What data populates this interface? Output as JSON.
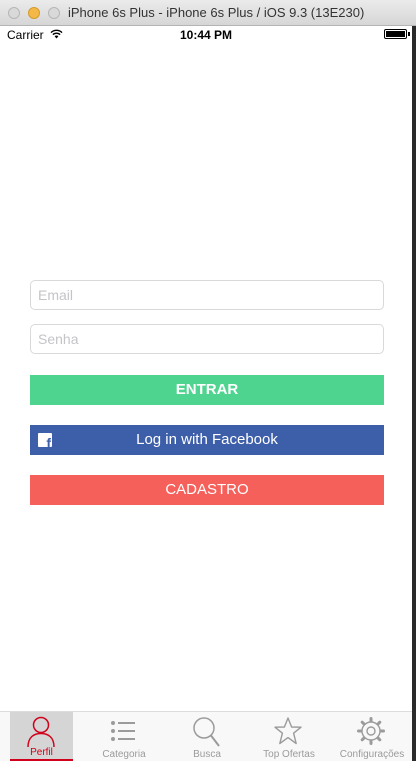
{
  "window": {
    "title": "iPhone 6s Plus - iPhone 6s Plus / iOS 9.3 (13E230)"
  },
  "status_bar": {
    "carrier": "Carrier",
    "time": "10:44 PM",
    "wifi_icon": "wifi-icon",
    "battery_icon": "battery-full-icon"
  },
  "login": {
    "email_placeholder": "Email",
    "email_value": "",
    "senha_placeholder": "Senha",
    "senha_value": "",
    "entrar_label": "ENTRAR",
    "facebook_label": "Log in with Facebook",
    "facebook_icon": "facebook-icon",
    "cadastro_label": "CADASTRO"
  },
  "tab_bar": {
    "selected": "Perfil",
    "items": [
      {
        "label": "Perfil",
        "icon": "person-icon"
      },
      {
        "label": "Categoria",
        "icon": "list-icon"
      },
      {
        "label": "Busca",
        "icon": "search-icon"
      },
      {
        "label": "Top Ofertas",
        "icon": "star-icon"
      },
      {
        "label": "Configurações",
        "icon": "gear-icon"
      }
    ]
  },
  "colors": {
    "entrar": "#4fd48f",
    "facebook": "#3d5ea8",
    "cadastro": "#f5605b",
    "tab_active": "#d0021b",
    "tab_inactive": "#9b9b9b"
  }
}
